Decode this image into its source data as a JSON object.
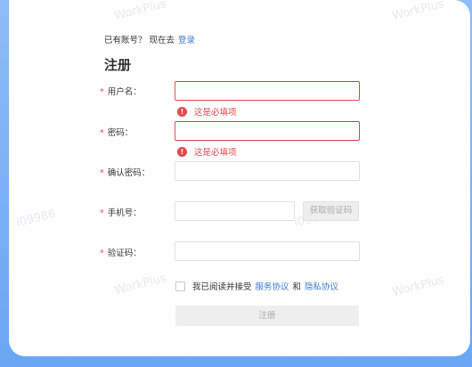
{
  "login_prompt": {
    "text": "已有账号？ 现在去",
    "link": "登录"
  },
  "title": "注册",
  "fields": {
    "username": {
      "label": "用户名：",
      "value": "",
      "error": "这是必填项"
    },
    "password": {
      "label": "密码：",
      "value": "",
      "error": "这是必填项"
    },
    "confirm_password": {
      "label": "确认密码：",
      "value": ""
    },
    "phone": {
      "label": "手机号：",
      "value": ""
    },
    "code": {
      "label": "验证码：",
      "value": ""
    }
  },
  "get_code_button": "获取验证码",
  "agreement": {
    "prefix": "我已阅读并接受",
    "service": "服务协议",
    "and": "和",
    "privacy": "隐私协议"
  },
  "submit_button": "注册",
  "watermarks": [
    "WorkPlus",
    "WorkPlus",
    "WorkPlus",
    "WorkPlus",
    "i09986",
    "i09986"
  ],
  "required_mark": "*",
  "error_icon": "exclamation-circle-icon",
  "colors": {
    "error": "#e5484d",
    "link": "#3a7bd5"
  }
}
